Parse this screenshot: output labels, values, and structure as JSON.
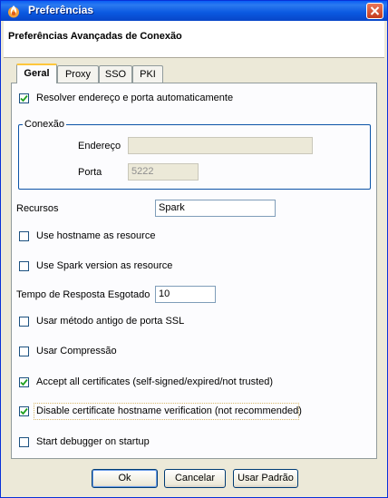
{
  "window": {
    "title": "Preferências"
  },
  "header": {
    "title": "Preferências Avançadas de Conexão"
  },
  "tabs": [
    {
      "label": "Geral"
    },
    {
      "label": "Proxy"
    },
    {
      "label": "SSO"
    },
    {
      "label": "PKI"
    }
  ],
  "general": {
    "auto_resolve": {
      "label": "Resolver endereço e porta automaticamente",
      "checked": true
    },
    "connection_group": {
      "legend": "Conexão",
      "address_label": "Endereço",
      "address_value": "",
      "port_label": "Porta",
      "port_value": "5222"
    },
    "resource_label": "Recursos",
    "resource_value": "Spark",
    "hostname_resource": {
      "label": "Use hostname as resource",
      "checked": false
    },
    "spark_version_resource": {
      "label": "Use Spark version as resource",
      "checked": false
    },
    "timeout_label": "Tempo de Resposta Esgotado",
    "timeout_value": "10",
    "old_ssl": {
      "label": "Usar método antigo de porta SSL",
      "checked": false
    },
    "compression": {
      "label": "Usar Compressão",
      "checked": false
    },
    "accept_certs": {
      "label": "Accept all certificates (self-signed/expired/not trusted)",
      "checked": true
    },
    "disable_hostname_verif": {
      "label": "Disable certificate hostname verification (not recommended)",
      "checked": true
    },
    "debugger": {
      "label": "Start debugger on startup",
      "checked": false
    }
  },
  "buttons": {
    "ok": "Ok",
    "cancel": "Cancelar",
    "default": "Usar Padrão"
  }
}
